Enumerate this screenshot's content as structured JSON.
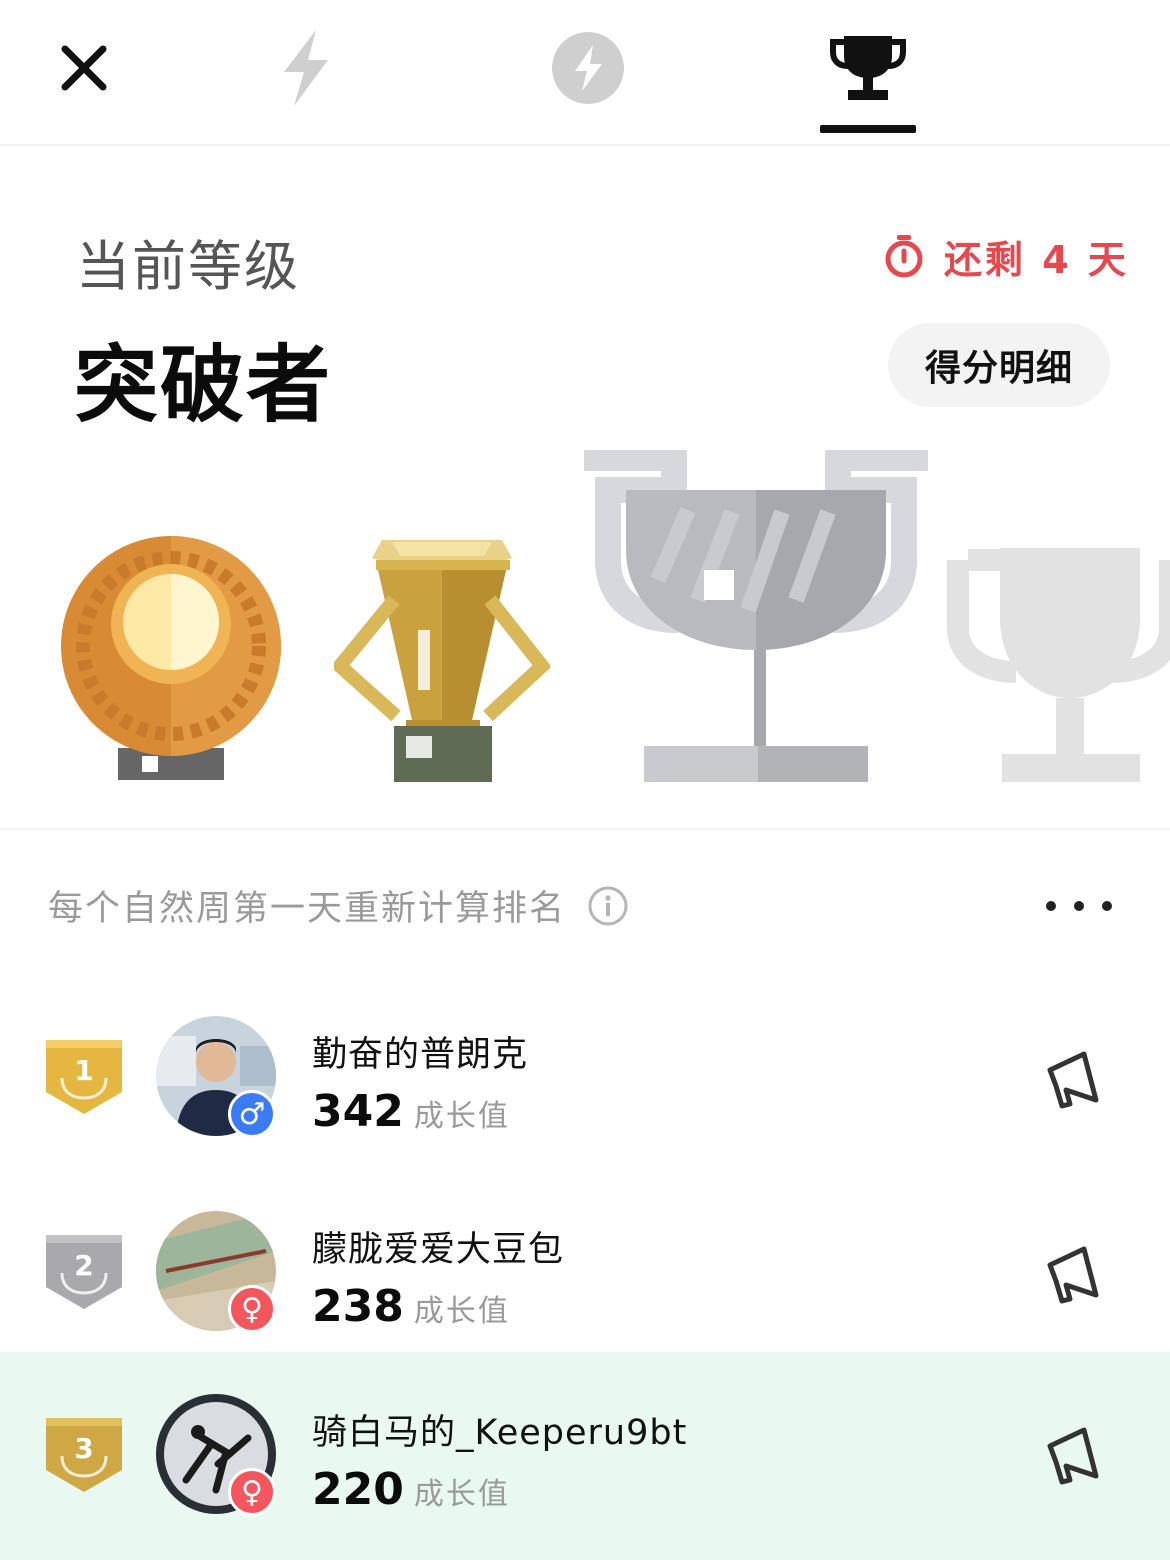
{
  "tabs": [
    {
      "icon": "close-icon"
    },
    {
      "icon": "lightning-icon"
    },
    {
      "icon": "lightning-circle-icon"
    },
    {
      "icon": "trophy-icon",
      "active": true
    }
  ],
  "level": {
    "label": "当前等级",
    "name": "突破者",
    "countdown": "还剩 4 天",
    "score_button": "得分明细"
  },
  "trophies": [
    {
      "icon": "bronze-medal-icon"
    },
    {
      "icon": "gold-cup-icon"
    },
    {
      "icon": "silver-trophy-icon"
    },
    {
      "icon": "locked-trophy-icon"
    }
  ],
  "ranking": {
    "note": "每个自然周第一天重新计算排名",
    "unit": "成长值",
    "rows": [
      {
        "rank": "1",
        "name": "勤奋的普朗克",
        "score": "342",
        "gender": "♂"
      },
      {
        "rank": "2",
        "name": "朦胧爱爱大豆包",
        "score": "238",
        "gender": "♀"
      },
      {
        "rank": "3",
        "name": "骑白马的_Keeperu9bt",
        "score": "220",
        "gender": "♀"
      }
    ]
  },
  "colors": {
    "accent_red": "#e5484d",
    "highlight_row": "#e9f9f1",
    "male": "#3b7cf6",
    "female": "#f4565e"
  }
}
